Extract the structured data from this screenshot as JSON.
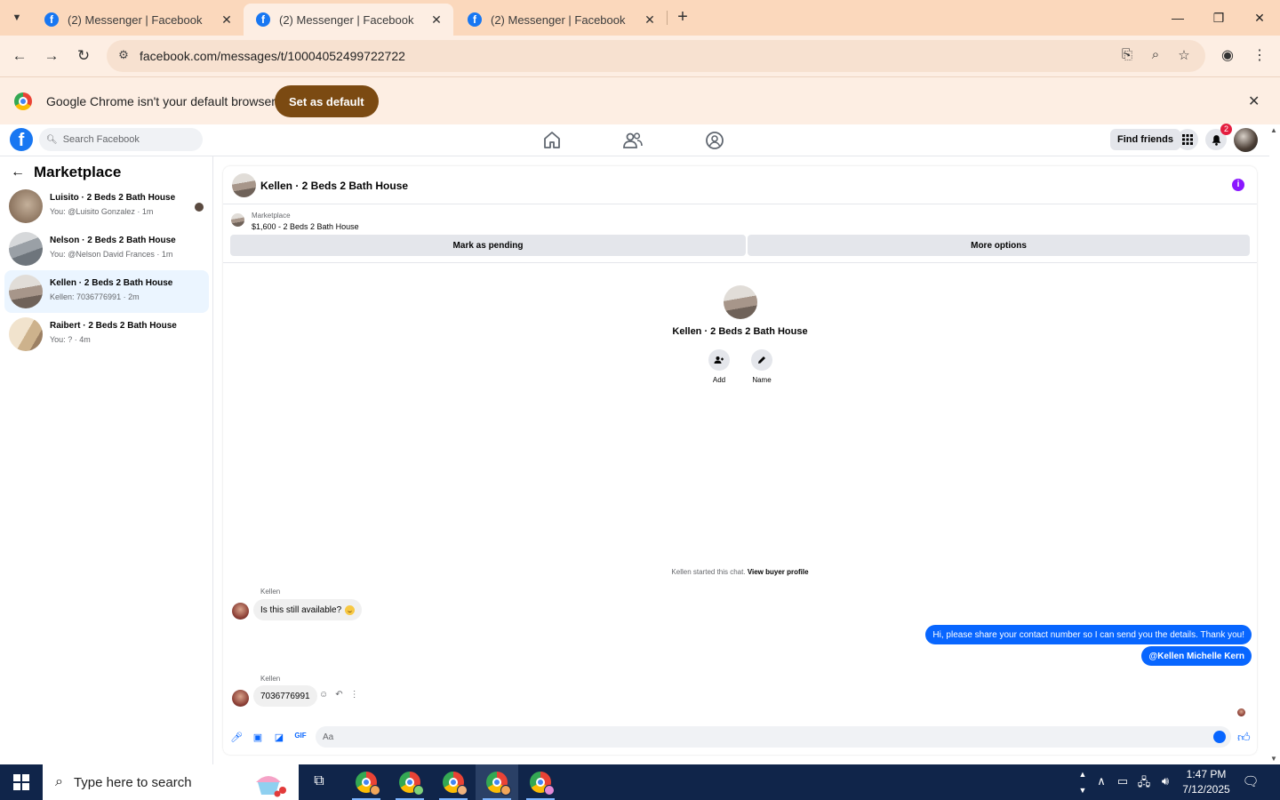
{
  "browser": {
    "tabs": [
      {
        "title": "(2) Messenger | Facebook",
        "active": false
      },
      {
        "title": "(2) Messenger | Facebook",
        "active": true
      },
      {
        "title": "(2) Messenger | Facebook",
        "active": false
      }
    ],
    "url": "facebook.com/messages/t/10004052499722722",
    "infobar": {
      "message": "Google Chrome isn't your default browser",
      "button_label": "Set as default"
    }
  },
  "fb_header": {
    "search_placeholder": "Search Facebook",
    "find_friends_label": "Find friends",
    "notification_count": "2"
  },
  "sidebar": {
    "title": "Marketplace",
    "conversations": [
      {
        "title": "Luisito · 2 Beds 2 Bath House",
        "subtitle": "You: @Luisito Gonzalez · 1m",
        "unread": true,
        "selected": false
      },
      {
        "title": "Nelson · 2 Beds 2 Bath House",
        "subtitle": "You: @Nelson David Frances · 1m",
        "unread": false,
        "selected": false
      },
      {
        "title": "Kellen · 2 Beds 2 Bath House",
        "subtitle": "Kellen: 7036776991 · 2m",
        "unread": false,
        "selected": true
      },
      {
        "title": "Raibert · 2 Beds 2 Bath House",
        "subtitle": "You: ? · 4m",
        "unread": false,
        "selected": false
      }
    ]
  },
  "chat": {
    "title": "Kellen · 2 Beds 2 Bath House",
    "listing": {
      "label": "Marketplace",
      "price_title": "$1,600 - 2 Beds 2 Bath House",
      "mark_pending_label": "Mark as pending",
      "more_options_label": "More options"
    },
    "profile": {
      "name": "Kellen · 2 Beds 2 Bath House",
      "add_label": "Add",
      "name_label": "Name"
    },
    "system_message": "Kellen started this chat.",
    "system_link": "View buyer profile",
    "messages": [
      {
        "sender": "Kellen",
        "text": "Is this still available?",
        "direction": "in"
      },
      {
        "text": "Hi, please share your contact number so I can send you the details. Thank you!",
        "direction": "out"
      },
      {
        "text": "@Kellen Michelle Kern",
        "direction": "out"
      },
      {
        "sender": "Kellen",
        "text": "7036776991",
        "direction": "in"
      }
    ],
    "composer_placeholder": "Aa"
  },
  "taskbar": {
    "search_placeholder": "Type here to search",
    "time": "1:47 PM",
    "date": "7/12/2025"
  },
  "colors": {
    "tab_strip": "#fbd8bc",
    "toolbar": "#fdeee3",
    "set_default_button": "#7b4a12",
    "facebook_blue": "#1877f2",
    "outgoing_bubble": "#0866ff",
    "info_icon": "#8a17ff",
    "taskbar": "#10254a"
  }
}
